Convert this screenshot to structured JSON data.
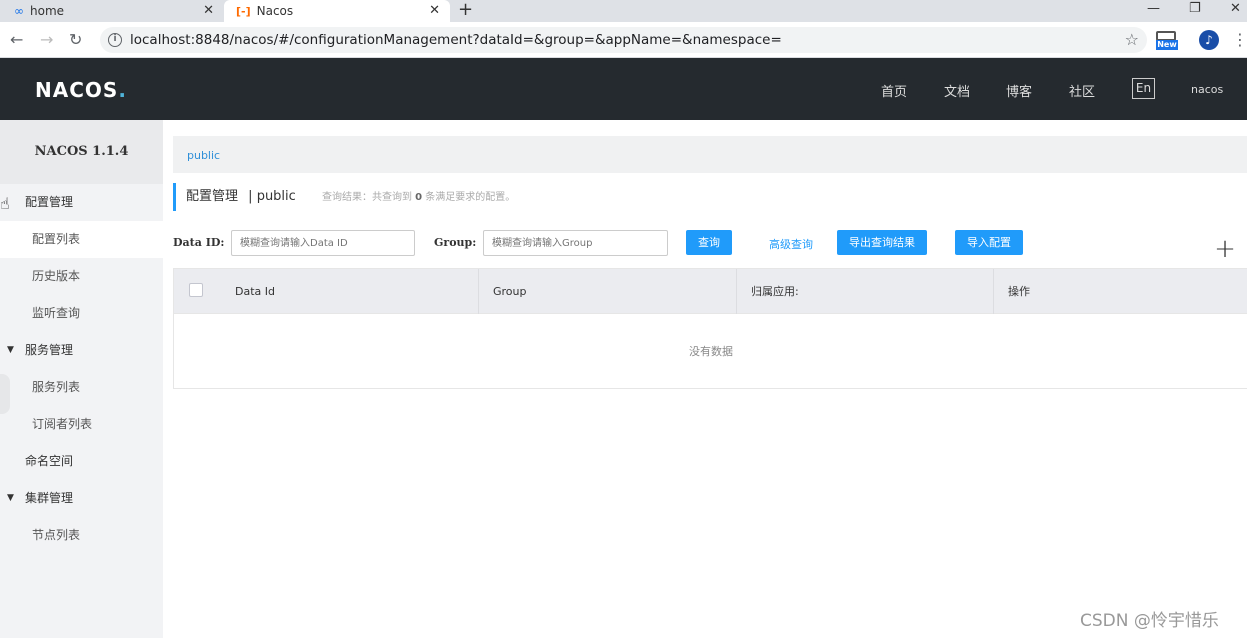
{
  "browser": {
    "tabs": [
      {
        "title": "home",
        "icon": "infinity-icon"
      },
      {
        "title": "Nacos",
        "icon": "nacos-bracket-icon"
      }
    ],
    "new_tab": "+",
    "url": "localhost:8848/nacos/#/configurationManagement?dataId=&group=&appName=&namespace=",
    "ext_new_label": "New"
  },
  "header": {
    "logo": "NACOS",
    "logo_dot": ".",
    "nav": [
      "首页",
      "文档",
      "博客",
      "社区"
    ],
    "lang": "En",
    "user": "nacos"
  },
  "sidebar": {
    "version": "NACOS 1.1.4",
    "groups": [
      {
        "label": "配置管理",
        "items": [
          "配置列表",
          "历史版本",
          "监听查询"
        ]
      },
      {
        "label": "服务管理",
        "items": [
          "服务列表",
          "订阅者列表"
        ]
      },
      {
        "label": "命名空间"
      },
      {
        "label": "集群管理",
        "items": [
          "节点列表"
        ]
      }
    ]
  },
  "main": {
    "namespace_tab": "public",
    "title": "配置管理",
    "title_sep": "|",
    "title_ns": "public",
    "result_prefix": "查询结果：共查询到",
    "result_count": "0",
    "result_suffix": "条满足要求的配置。",
    "filters": {
      "data_id_label": "Data ID:",
      "data_id_placeholder": "模糊查询请输入Data ID",
      "group_label": "Group:",
      "group_placeholder": "模糊查询请输入Group",
      "query_button": "查询",
      "advanced_link": "高级查询",
      "export_button": "导出查询结果",
      "import_button": "导入配置",
      "add_button": "+"
    },
    "table": {
      "columns": [
        "Data Id",
        "Group",
        "归属应用:",
        "操作"
      ],
      "empty_text": "没有数据"
    }
  },
  "watermark": "CSDN @怜宇惜乐",
  "colors": {
    "header_bg": "#252a2f",
    "primary": "#209bfa",
    "sidebar_bg": "#f2f3f5"
  }
}
